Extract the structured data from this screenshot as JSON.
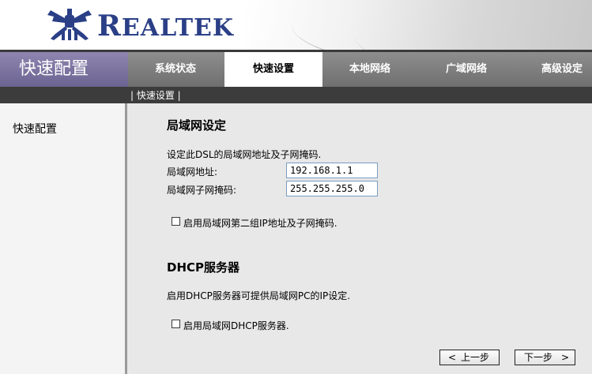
{
  "brand": {
    "logo_first": "R",
    "logo_rest": "EALTEK"
  },
  "page_title": "快速配置",
  "tabs": [
    {
      "label": "系统状态"
    },
    {
      "label": "快速设置"
    },
    {
      "label": "本地网络"
    },
    {
      "label": "广域网络"
    },
    {
      "label": "高级设定"
    }
  ],
  "active_tab": "快速设置",
  "subnav": "| 快速设置 |",
  "sidebar": {
    "items": [
      {
        "label": "快速配置"
      }
    ]
  },
  "lan": {
    "heading": "局域网设定",
    "description": "设定此DSL的局域网地址及子网掩码.",
    "ip_label": "局域网地址:",
    "ip_value": "192.168.1.1",
    "mask_label": "局域网子网掩码:",
    "mask_value": "255.255.255.0",
    "second_ip_label": "启用局域网第二组IP地址及子网掩码."
  },
  "dhcp": {
    "heading": "DHCP服务器",
    "description": "启用DHCP服务器可提供局域网PC的IP设定.",
    "enable_label": "启用局域网DHCP服务器."
  },
  "buttons": {
    "prev_label": "上一步",
    "prev_arrow": "<",
    "next_label": "下一步",
    "next_arrow": ">"
  }
}
